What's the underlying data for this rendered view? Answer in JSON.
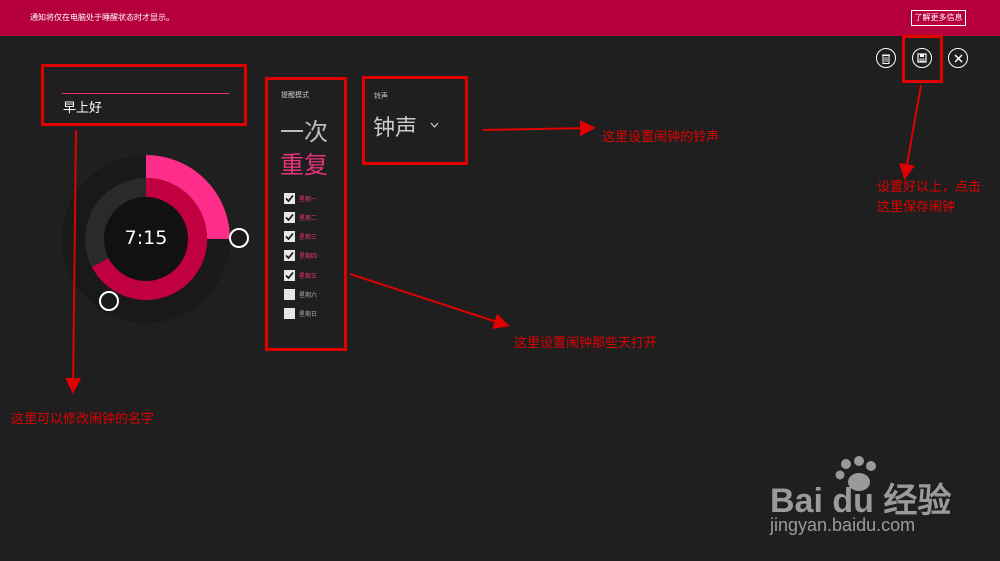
{
  "banner": {
    "message": "通知将仅在电脑处于睡醒状态时才显示。",
    "more_button": "了解更多信息"
  },
  "alarm": {
    "name": "早上好",
    "time": "7:15"
  },
  "reminder": {
    "label": "提醒模式",
    "once": "一次",
    "repeat": "重复",
    "days": [
      {
        "label": "星期一",
        "checked": true
      },
      {
        "label": "星期二",
        "checked": true
      },
      {
        "label": "星期三",
        "checked": true
      },
      {
        "label": "星期四",
        "checked": true
      },
      {
        "label": "星期五",
        "checked": true
      },
      {
        "label": "星期六",
        "checked": false
      },
      {
        "label": "星期日",
        "checked": false
      }
    ]
  },
  "ringtone": {
    "label": "铃声",
    "value": "钟声"
  },
  "toolbar": {
    "delete_icon": "trash-icon",
    "save_icon": "save-icon",
    "close_icon": "close-icon"
  },
  "annotations": {
    "ringtone_note": "这里设置闹钟的铃声",
    "save_note_line1": "设置好以上，点击",
    "save_note_line2": "这里保存闹钟",
    "days_note": "这里设置闹钟那些天打开",
    "name_note": "这里可以修改闹钟的名字"
  },
  "watermark": {
    "brand": "Bai du 经验",
    "url": "jingyan.baidu.com"
  },
  "colors": {
    "accent": "#e8327a",
    "banner": "#b5003b",
    "annotation_red": "#e00000",
    "background": "#1f1f1f"
  }
}
